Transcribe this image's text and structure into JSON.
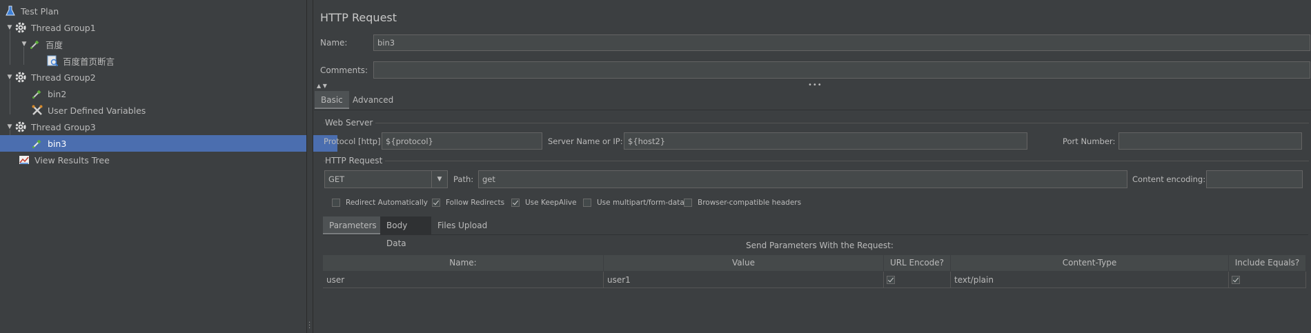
{
  "tree": {
    "items": [
      {
        "label": "Test Plan",
        "icon": "flask-icon"
      },
      {
        "label": "Thread Group1",
        "icon": "gear-icon"
      },
      {
        "label": "百度",
        "icon": "pipette-icon"
      },
      {
        "label": "百度首页断言",
        "icon": "assertion-icon"
      },
      {
        "label": "Thread Group2",
        "icon": "gear-icon"
      },
      {
        "label": "bin2",
        "icon": "pipette-icon"
      },
      {
        "label": "User Defined Variables",
        "icon": "wrench-icon"
      },
      {
        "label": "Thread Group3",
        "icon": "gear-icon"
      },
      {
        "label": "bin3",
        "icon": "pipette-icon"
      },
      {
        "label": "View Results Tree",
        "icon": "graph-icon"
      }
    ]
  },
  "panel": {
    "title": "HTTP Request",
    "name_label": "Name:",
    "name_value": "bin3",
    "comments_label": "Comments:",
    "comments_value": ""
  },
  "tabs": [
    {
      "label": "Basic",
      "active": true
    },
    {
      "label": "Advanced",
      "active": false
    }
  ],
  "web_server": {
    "title": "Web Server",
    "protocol_label": "Protocol [http]:",
    "protocol_value": "${protocol}",
    "server_label": "Server Name or IP:",
    "server_value": "${host2}",
    "port_label": "Port Number:",
    "port_value": ""
  },
  "http_request": {
    "title": "HTTP Request",
    "method": "GET",
    "path_label": "Path:",
    "path_value": "get",
    "encoding_label": "Content encoding:",
    "encoding_value": ""
  },
  "options": [
    {
      "label": "Redirect Automatically",
      "checked": false
    },
    {
      "label": "Follow Redirects",
      "checked": true
    },
    {
      "label": "Use KeepAlive",
      "checked": true
    },
    {
      "label": "Use multipart/form-data",
      "checked": false
    },
    {
      "label": "Browser-compatible headers",
      "checked": false
    }
  ],
  "sub_tabs": [
    {
      "label": "Parameters",
      "active": true
    },
    {
      "label": "Body Data",
      "active": false
    },
    {
      "label": "Files Upload",
      "active": false
    }
  ],
  "params": {
    "caption": "Send Parameters With the Request:",
    "headers": [
      "Name:",
      "Value",
      "URL Encode?",
      "Content-Type",
      "Include Equals?"
    ],
    "rows": [
      {
        "name": "user",
        "value": "user1",
        "url_encode": true,
        "content_type": "text/plain",
        "include_equals": true
      }
    ]
  }
}
